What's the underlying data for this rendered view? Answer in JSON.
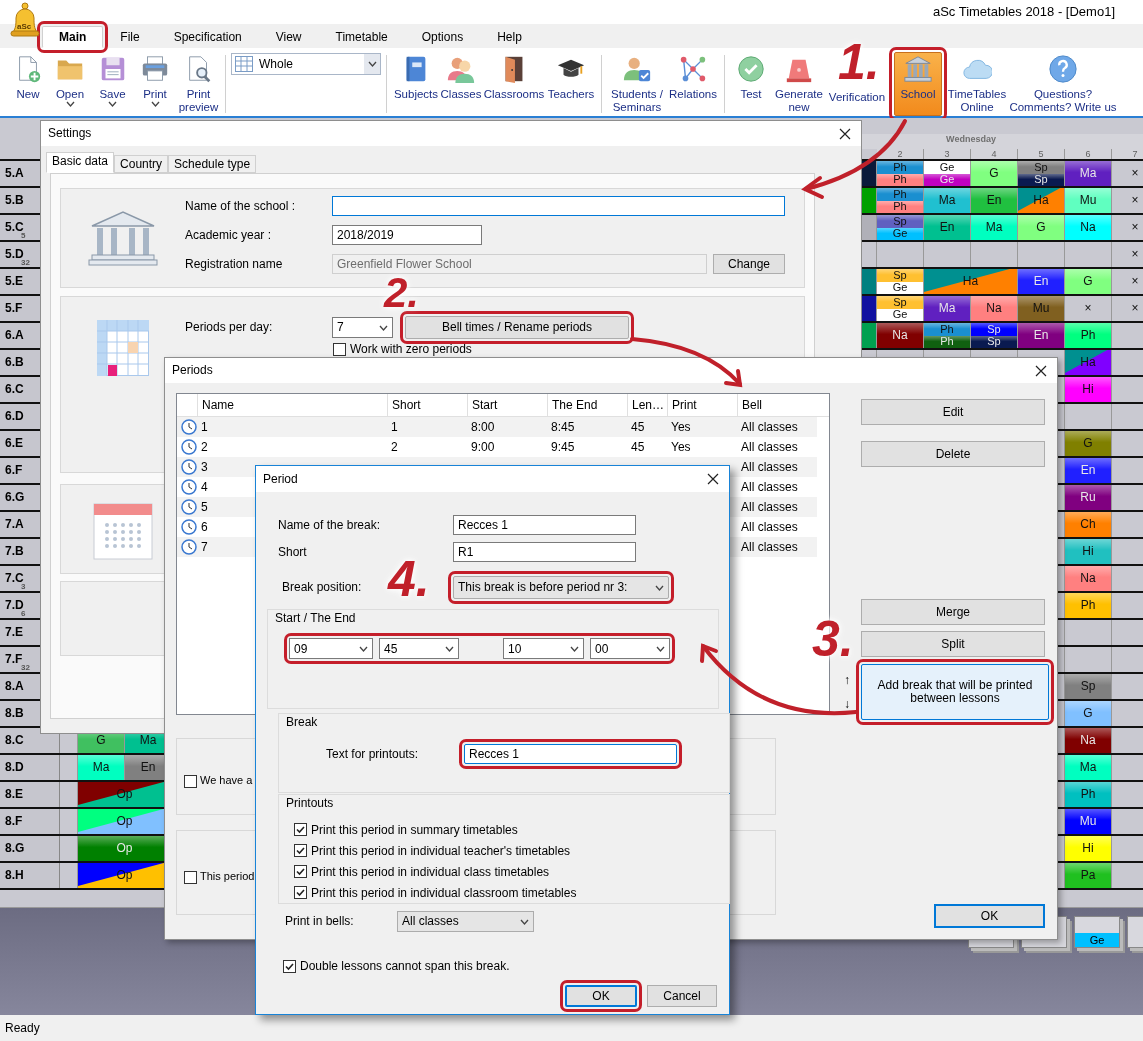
{
  "window": {
    "title": "aSc Timetables 2018  - [Demo1]",
    "logo_text": "aSc"
  },
  "menu_tabs": [
    {
      "label": "Main",
      "selected": true,
      "annotated": true
    },
    {
      "label": "File",
      "selected": false
    },
    {
      "label": "Specification",
      "selected": false
    },
    {
      "label": "View",
      "selected": false
    },
    {
      "label": "Timetable",
      "selected": false
    },
    {
      "label": "Options",
      "selected": false
    },
    {
      "label": "Help",
      "selected": false
    }
  ],
  "ribbon_groups": [
    [
      {
        "label": "New",
        "dropdown": false,
        "selected": false
      },
      {
        "label": "Open",
        "dropdown": true,
        "selected": false
      },
      {
        "label": "Save",
        "dropdown": true,
        "selected": false
      },
      {
        "label": "Print",
        "dropdown": true,
        "selected": false
      },
      {
        "label": "Print\npreview",
        "dropdown": false,
        "selected": false
      }
    ],
    [
      {
        "label": "Subjects",
        "dropdown": false,
        "selected": false
      },
      {
        "label": "Classes",
        "dropdown": false,
        "selected": false
      },
      {
        "label": "Classrooms",
        "dropdown": false,
        "selected": false
      },
      {
        "label": "Teachers",
        "dropdown": false,
        "selected": false
      }
    ],
    [
      {
        "label": "Students /\nSeminars",
        "dropdown": false,
        "selected": false
      },
      {
        "label": "Relations",
        "dropdown": false,
        "selected": false
      }
    ],
    [
      {
        "label": "Test",
        "dropdown": false,
        "selected": false
      },
      {
        "label": "Generate\nnew",
        "dropdown": false,
        "selected": false
      },
      {
        "label": "Verification",
        "dropdown": false,
        "selected": false
      },
      {
        "label": "School",
        "dropdown": false,
        "selected": true,
        "annotated": true
      },
      {
        "label": "TimeTables\nOnline",
        "dropdown": false,
        "selected": false
      },
      {
        "label": "Questions?\nComments? Write us",
        "dropdown": false,
        "selected": false
      }
    ]
  ],
  "view_select": {
    "value": "Whole"
  },
  "timetable": {
    "day": "Wednesday",
    "periods": [
      "2",
      "3",
      "4",
      "5",
      "6",
      "7"
    ],
    "rows": [
      {
        "class": "5.A",
        "edge": {
          "color": "#0a1a3a"
        },
        "cells": [
          {
            "kind": "split",
            "top": {
              "text": "Ph",
              "color": "#1a8fd0"
            },
            "bottom": {
              "text": "Ph",
              "color": "#ff8080"
            }
          },
          {
            "kind": "split",
            "top": {
              "text": "Ge",
              "color": "#ffffff"
            },
            "bottom": {
              "text": "Ge",
              "color": "#c000c0"
            }
          },
          {
            "kind": "single",
            "text": "G",
            "color": "#80ff80"
          },
          {
            "kind": "split",
            "top": {
              "text": "Sp",
              "color": "#808080"
            },
            "bottom": {
              "text": "Sp",
              "color": "#0a1a50"
            }
          },
          {
            "kind": "single",
            "text": "Ma",
            "color": "#6020c0"
          },
          {
            "kind": "cross",
            "text": "×"
          }
        ]
      },
      {
        "class": "5.B",
        "edge": {
          "color": "#00a000"
        },
        "cells": [
          {
            "kind": "split",
            "top": {
              "text": "Ph",
              "color": "#1a8fd0"
            },
            "bottom": {
              "text": "Ph",
              "color": "#ff8080"
            }
          },
          {
            "kind": "single",
            "text": "Ma",
            "color": "#20c0d0"
          },
          {
            "kind": "single",
            "text": "En",
            "color": "#20c040"
          },
          {
            "kind": "diagonal",
            "text": "Ha",
            "color": "#009090",
            "corner": {
              "color": "#ff8000"
            }
          },
          {
            "kind": "single",
            "text": "Mu",
            "color": "#60ffc0"
          },
          {
            "kind": "cross",
            "text": "×"
          }
        ]
      },
      {
        "class": "5.C",
        "sub": "5",
        "edge": {
          "color": "#b0b0b8"
        },
        "cells": [
          {
            "kind": "split",
            "top": {
              "text": "Sp",
              "color": "#6060c0"
            },
            "bottom": {
              "text": "Ge",
              "color": "#00c0ff"
            }
          },
          {
            "kind": "single",
            "text": "En",
            "color": "#00c090"
          },
          {
            "kind": "single",
            "text": "Ma",
            "color": "#00ffc0"
          },
          {
            "kind": "single",
            "text": "G",
            "color": "#80ff80"
          },
          {
            "kind": "single",
            "text": "Na",
            "color": "#00ffff"
          },
          {
            "kind": "cross",
            "text": "×"
          }
        ]
      },
      {
        "class": "5.D",
        "sub": "32",
        "cells": [
          {
            "kind": "empty"
          },
          {
            "kind": "empty"
          },
          {
            "kind": "empty"
          },
          {
            "kind": "empty"
          },
          {
            "kind": "empty"
          },
          {
            "kind": "cross",
            "text": "×"
          }
        ]
      },
      {
        "class": "5.E",
        "edge": {
          "color": "#008080"
        },
        "cells": [
          {
            "kind": "split",
            "top": {
              "text": "Sp",
              "color": "#ffc030"
            },
            "bottom": {
              "text": "Ge",
              "color": "#ffffff"
            }
          },
          {
            "kind": "diagonal",
            "text": "Ha",
            "color": "#009090",
            "corner": {
              "color": "#ff8000"
            }
          },
          {
            "kind": "continued"
          },
          {
            "kind": "single",
            "text": "En",
            "color": "#2020ff"
          },
          {
            "kind": "single",
            "text": "G",
            "color": "#80ff80"
          },
          {
            "kind": "cross",
            "text": "×"
          }
        ]
      },
      {
        "class": "5.F",
        "edge": {
          "color": "#1010a0"
        },
        "cells": [
          {
            "kind": "split",
            "top": {
              "text": "Sp",
              "color": "#ffc030"
            },
            "bottom": {
              "text": "Ge",
              "color": "#ffffff"
            }
          },
          {
            "kind": "single",
            "text": "Ma",
            "color": "#6020c0"
          },
          {
            "kind": "single",
            "text": "Na",
            "color": "#ff8080"
          },
          {
            "kind": "single",
            "text": "Mu",
            "color": "#806020"
          },
          {
            "kind": "cross",
            "text": "×"
          },
          {
            "kind": "cross",
            "text": "×"
          }
        ]
      },
      {
        "class": "6.A",
        "edge": {
          "color": "#00a050"
        },
        "cells": [
          {
            "kind": "single",
            "text": "Na",
            "color": "#800000"
          },
          {
            "kind": "split",
            "top": {
              "text": "Ph",
              "color": "#1a8fd0"
            },
            "bottom": {
              "text": "Ph",
              "color": "#106010"
            }
          },
          {
            "kind": "split",
            "top": {
              "text": "Sp",
              "color": "#0000ff"
            },
            "bottom": {
              "text": "Sp",
              "color": "#0a1a50"
            }
          },
          {
            "kind": "single",
            "text": "En",
            "color": "#800080"
          },
          {
            "kind": "single",
            "text": "Ph",
            "color": "#00ff80"
          },
          {
            "kind": "empty"
          }
        ]
      },
      {
        "class": "6.B",
        "cells": [
          null,
          null,
          null,
          null,
          {
            "kind": "diagonal",
            "text": "Ha",
            "color": "#009090",
            "corner": {
              "color": "#8000ff"
            }
          },
          {
            "kind": "empty"
          }
        ]
      },
      {
        "class": "6.C",
        "cells": [
          null,
          null,
          null,
          null,
          {
            "kind": "single",
            "text": "Hi",
            "color": "#ff00ff"
          },
          {
            "kind": "empty"
          }
        ]
      },
      {
        "class": "6.D",
        "cells": [
          null,
          null,
          null,
          null,
          {
            "kind": "empty"
          },
          {
            "kind": "empty"
          }
        ]
      },
      {
        "class": "6.E",
        "cells": [
          null,
          null,
          null,
          null,
          {
            "kind": "single",
            "text": "G",
            "color": "#808000"
          },
          {
            "kind": "empty"
          }
        ]
      },
      {
        "class": "6.F",
        "cells": [
          null,
          null,
          null,
          null,
          {
            "kind": "single",
            "text": "En",
            "color": "#2020ff"
          },
          {
            "kind": "empty"
          }
        ]
      },
      {
        "class": "6.G",
        "cells": [
          null,
          null,
          null,
          null,
          {
            "kind": "single",
            "text": "Ru",
            "color": "#800080"
          },
          {
            "kind": "empty"
          }
        ]
      },
      {
        "class": "7.A",
        "cells": [
          null,
          null,
          null,
          null,
          {
            "kind": "single",
            "text": "Ch",
            "color": "#ff8000"
          },
          {
            "kind": "empty"
          }
        ]
      },
      {
        "class": "7.B",
        "cells": [
          null,
          null,
          null,
          null,
          {
            "kind": "single",
            "text": "Hi",
            "color": "#20c0c0"
          },
          {
            "kind": "empty"
          }
        ]
      },
      {
        "class": "7.C",
        "sub": "3",
        "cells": [
          null,
          null,
          null,
          null,
          {
            "kind": "single",
            "text": "Na",
            "color": "#ff8080"
          },
          {
            "kind": "empty"
          }
        ]
      },
      {
        "class": "7.D",
        "sub": "6",
        "cells": [
          null,
          null,
          null,
          null,
          {
            "kind": "single",
            "text": "Ph",
            "color": "#ffc000"
          },
          {
            "kind": "empty"
          }
        ]
      },
      {
        "class": "7.E",
        "cells": [
          null,
          null,
          null,
          null,
          {
            "kind": "empty"
          },
          {
            "kind": "empty"
          }
        ]
      },
      {
        "class": "7.F",
        "sub": "32",
        "cells": [
          null,
          null,
          null,
          null,
          {
            "kind": "empty"
          },
          {
            "kind": "empty"
          }
        ]
      },
      {
        "class": "8.A",
        "cells": [
          null,
          null,
          null,
          null,
          {
            "kind": "single",
            "text": "Sp",
            "color": "#808080"
          },
          {
            "kind": "empty"
          }
        ]
      },
      {
        "class": "8.B",
        "cells": [
          null,
          null,
          null,
          null,
          {
            "kind": "single",
            "text": "G",
            "color": "#80c0ff"
          },
          {
            "kind": "empty"
          }
        ]
      },
      {
        "class": "8.C",
        "first_cells": [
          {
            "kind": "single",
            "text": "G",
            "color": "#40c060"
          },
          {
            "kind": "single",
            "text": "Ma",
            "color": "#00c090"
          }
        ],
        "cells": [
          null,
          null,
          null,
          null,
          {
            "kind": "single",
            "text": "Na",
            "color": "#800000"
          },
          {
            "kind": "empty"
          }
        ]
      },
      {
        "class": "8.D",
        "first_cells": [
          {
            "kind": "single",
            "text": "Ma",
            "color": "#00ffc0"
          },
          {
            "kind": "single",
            "text": "En",
            "color": "#808080"
          }
        ],
        "cells": [
          null,
          null,
          null,
          null,
          {
            "kind": "single",
            "text": "Ma",
            "color": "#00ffc0"
          },
          {
            "kind": "empty"
          }
        ]
      },
      {
        "class": "8.E",
        "first_cells": [
          {
            "kind": "diagonal",
            "text": "Op",
            "color": "#800000",
            "corner": {
              "color": "#00c090"
            }
          },
          {
            "kind": "continued"
          }
        ],
        "cells": [
          null,
          null,
          null,
          null,
          {
            "kind": "single",
            "text": "Ph",
            "color": "#00c0c0"
          },
          {
            "kind": "empty"
          }
        ]
      },
      {
        "class": "8.F",
        "first_cells": [
          {
            "kind": "diagonal",
            "text": "Op",
            "color": "#00ff80",
            "corner": {
              "color": "#80c0ff"
            }
          },
          {
            "kind": "continued"
          }
        ],
        "cells": [
          null,
          null,
          null,
          null,
          {
            "kind": "single",
            "text": "Mu",
            "color": "#0000ff"
          },
          {
            "kind": "empty"
          }
        ]
      },
      {
        "class": "8.G",
        "first_cells": [
          {
            "kind": "single",
            "text": "Op",
            "color": "#008000"
          },
          {
            "kind": "continued"
          }
        ],
        "cells": [
          null,
          null,
          null,
          null,
          {
            "kind": "single",
            "text": "Hi",
            "color": "#ffff00"
          },
          {
            "kind": "empty"
          }
        ]
      },
      {
        "class": "8.H",
        "first_cells": [
          {
            "kind": "diagonal",
            "text": "Op",
            "color": "#0000ff",
            "corner": {
              "color": "#ffc000"
            }
          },
          {
            "kind": "continued"
          }
        ],
        "cells": [
          null,
          null,
          null,
          null,
          {
            "kind": "single",
            "text": "Pa",
            "color": "#20c020"
          },
          {
            "kind": "empty"
          }
        ]
      }
    ]
  },
  "card_tray": [
    {
      "text": "Ge",
      "color": "#00c0ff"
    }
  ],
  "settings": {
    "title": "Settings",
    "tabs": [
      {
        "label": "Basic data",
        "selected": true
      },
      {
        "label": "Country",
        "selected": false
      },
      {
        "label": "Schedule type",
        "selected": false
      }
    ],
    "school_name": {
      "label": "Name of the school :",
      "focused": true
    },
    "academic_year": {
      "label": "Academic year :",
      "value": "2018/2019"
    },
    "registration": {
      "label": "Registration name",
      "value": "Greenfield Flower School",
      "disabled": true,
      "button": "Change"
    },
    "periods_per_day": {
      "label": "Periods per day:",
      "value": "7"
    },
    "bell_button": {
      "label": "Bell times / Rename periods",
      "annotated": true
    },
    "zero_periods": {
      "label": "Work with zero periods",
      "checked": false
    }
  },
  "periods_window": {
    "title": "Periods",
    "columns": [
      "Name",
      "Short",
      "Start",
      "The End",
      "Len…",
      "Print",
      "Bell"
    ],
    "rows": [
      {
        "name": "1",
        "short": "1",
        "start": "8:00",
        "end": "8:45",
        "length": "45",
        "print": "Yes",
        "bell": "All classes"
      },
      {
        "name": "2",
        "short": "2",
        "start": "9:00",
        "end": "9:45",
        "length": "45",
        "print": "Yes",
        "bell": "All classes"
      },
      {
        "name": "3",
        "bell": "All classes"
      },
      {
        "name": "4",
        "bell": "All classes"
      },
      {
        "name": "5",
        "bell": "All classes"
      },
      {
        "name": "6",
        "bell": "All classes"
      },
      {
        "name": "7",
        "bell": "All classes"
      }
    ],
    "buttons": [
      {
        "label": "Edit"
      },
      {
        "label": "Delete"
      },
      {
        "label": "Merge"
      },
      {
        "label": "Split"
      }
    ],
    "add_break": {
      "label": "Add break that will be printed between lessons",
      "annotated": true
    },
    "move_up": "↑",
    "move_down": "↓",
    "options": [
      {
        "label": "We have a",
        "checked": false
      },
      {
        "label": "This period",
        "checked": false
      }
    ],
    "ok_button": "OK"
  },
  "period_dialog": {
    "title": "Period",
    "break_name": {
      "label": "Name of the break:",
      "value": "Recces 1"
    },
    "short": {
      "label": "Short",
      "value": "R1"
    },
    "position": {
      "label": "Break position:",
      "value": "This break is before period nr 3:",
      "annotated": true
    },
    "start_end": {
      "title": "Start / The End",
      "start_hour": "09",
      "start_minute": "45",
      "end_hour": "10",
      "end_minute": "00",
      "annotated": true
    },
    "break_group": {
      "title": "Break",
      "label": "Text for printouts:",
      "value": "Recces 1",
      "focused": true,
      "annotated": true
    },
    "printouts": {
      "title": "Printouts",
      "options": [
        {
          "label": "Print this period in summary timetables",
          "checked": true
        },
        {
          "label": "Print this period in individual teacher's timetables",
          "checked": true
        },
        {
          "label": "Print this period in individual class timetables",
          "checked": true
        },
        {
          "label": "Print this period in individual classroom timetables",
          "checked": true
        }
      ]
    },
    "bells": {
      "label": "Print in bells:",
      "value": "All classes"
    },
    "double_lessons": {
      "label": "Double lessons cannot span this break.",
      "checked": true
    },
    "ok_button": {
      "label": "OK",
      "annotated": true
    },
    "cancel_button": "Cancel"
  },
  "annotations": [
    {
      "text": "1."
    },
    {
      "text": "2."
    },
    {
      "text": "3."
    },
    {
      "text": "4."
    }
  ],
  "status_bar": "Ready"
}
